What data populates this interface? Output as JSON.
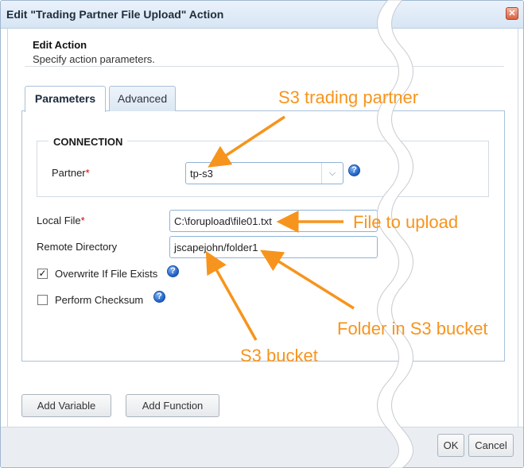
{
  "window": {
    "title": "Edit \"Trading Partner File Upload\" Action",
    "close_symbol": "✕"
  },
  "header": {
    "heading": "Edit Action",
    "subheading": "Specify action parameters."
  },
  "tabs": [
    {
      "label": "Parameters",
      "selected": true
    },
    {
      "label": "Advanced",
      "selected": false
    }
  ],
  "connection": {
    "legend": "CONNECTION",
    "partner_label": "Partner",
    "partner_value": "tp-s3"
  },
  "fields": {
    "local_file_label": "Local File",
    "local_file_value": "C:\\forupload\\file01.txt",
    "remote_dir_label": "Remote Directory",
    "remote_dir_value": "jscapejohn/folder1"
  },
  "options": {
    "overwrite_label": "Overwrite If File Exists",
    "overwrite_checked": true,
    "checksum_label": "Perform Checksum",
    "checksum_checked": false
  },
  "buttons": {
    "add_variable": "Add Variable",
    "add_function": "Add Function",
    "ok": "OK",
    "cancel": "Cancel"
  },
  "annotations": {
    "s3_partner": "S3 trading partner",
    "file_upload": "File to upload",
    "folder": "Folder in S3 bucket",
    "bucket": "S3 bucket"
  },
  "colors": {
    "annotation": "#f7941d",
    "accent_border": "#8eb3d6",
    "required": "#cc0000"
  },
  "icons": {
    "help": "help-icon",
    "dropdown": "chevron-down-icon",
    "close": "close-icon"
  }
}
